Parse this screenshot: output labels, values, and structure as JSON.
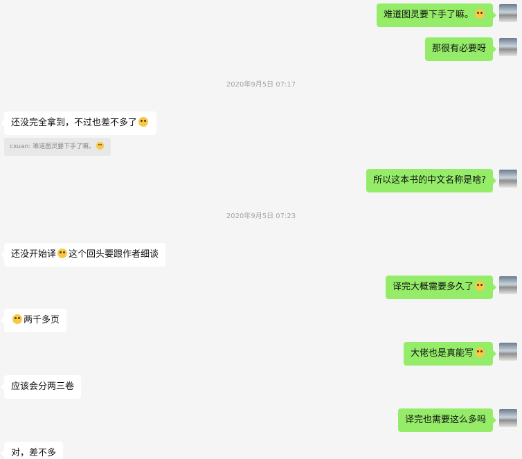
{
  "messages": {
    "m1": {
      "text": "难道图灵要下手了嘛。",
      "emoji": "smile-emoji"
    },
    "m2": {
      "text": "那很有必要呀"
    },
    "ts1": "2020年9月5日 07:17",
    "m3": {
      "text": "还没完全拿到，不过也差不多了",
      "emoji": "grin-emoji"
    },
    "quote1": {
      "author": "cxuan:",
      "text": "难道图灵要下手了嘛。",
      "emoji": "smile-emoji"
    },
    "m4": {
      "text": "所以这本书的中文名称是啥?"
    },
    "ts2": "2020年9月5日 07:23",
    "m5": {
      "text_before": "还没开始译",
      "text_after": "这个回头要跟作者细谈",
      "emoji": "facepalm-emoji"
    },
    "m6": {
      "text": "译完大概需要多久了",
      "emoji": "cat-emoji"
    },
    "m7": {
      "text": "两千多页",
      "emoji": "sweat-emoji"
    },
    "m8": {
      "text": "大佬也是真能写",
      "emoji": "surprised-emoji"
    },
    "m9": {
      "text": "应该会分两三卷"
    },
    "m10": {
      "text": "译完也需要这么多吗"
    },
    "m11": {
      "text": "对，差不多"
    }
  },
  "colors": {
    "background": "#f5f5f5",
    "my_bubble": "#95ec69",
    "their_bubble": "#ffffff",
    "timestamp_text": "#a3a3a3"
  }
}
